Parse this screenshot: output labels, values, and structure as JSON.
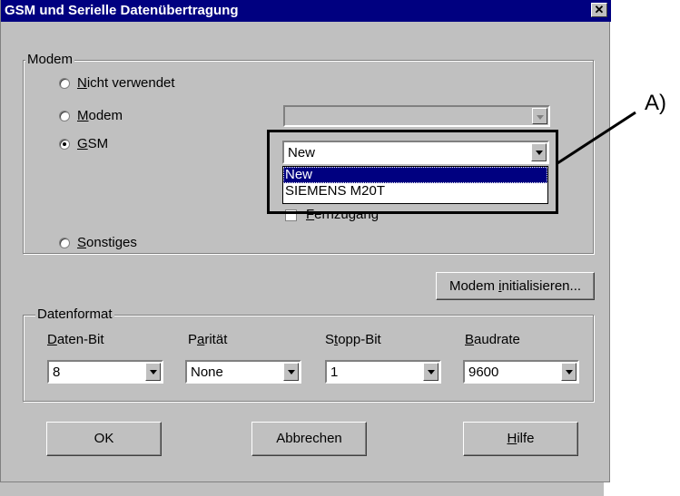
{
  "window": {
    "title": "GSM und Serielle Datenübertragung",
    "close_glyph": "✕"
  },
  "modem_group": {
    "legend": "Modem",
    "options": [
      {
        "pre": "",
        "key": "N",
        "post": "icht verwendet",
        "checked": false
      },
      {
        "pre": "",
        "key": "M",
        "post": "odem",
        "checked": false
      },
      {
        "pre": "",
        "key": "G",
        "post": "SM",
        "checked": true
      },
      {
        "pre": "",
        "key": "S",
        "post": "onstiges",
        "checked": false
      }
    ],
    "gsm_combo_value": "New",
    "gsm_dropdown_items": [
      "New",
      "SIEMENS M20T"
    ],
    "fernzugang": {
      "pre": "",
      "key": "F",
      "post": "ernzugang"
    },
    "init_button": {
      "pre": "Modem ",
      "key": "i",
      "post": "nitialisieren..."
    }
  },
  "format_group": {
    "legend": "Datenformat",
    "fields": [
      {
        "label_pre": "",
        "label_key": "D",
        "label_post": "aten-Bit",
        "value": "8"
      },
      {
        "label_pre": "P",
        "label_key": "a",
        "label_post": "rität",
        "value": "None"
      },
      {
        "label_pre": "S",
        "label_key": "t",
        "label_post": "opp-Bit",
        "value": "1"
      },
      {
        "label_pre": "",
        "label_key": "B",
        "label_post": "audrate",
        "value": "9600"
      }
    ]
  },
  "buttons": {
    "ok": "OK",
    "cancel": "Abbrechen",
    "help_key": "H",
    "help_post": "ilfe"
  },
  "callout": {
    "label": "A)"
  }
}
